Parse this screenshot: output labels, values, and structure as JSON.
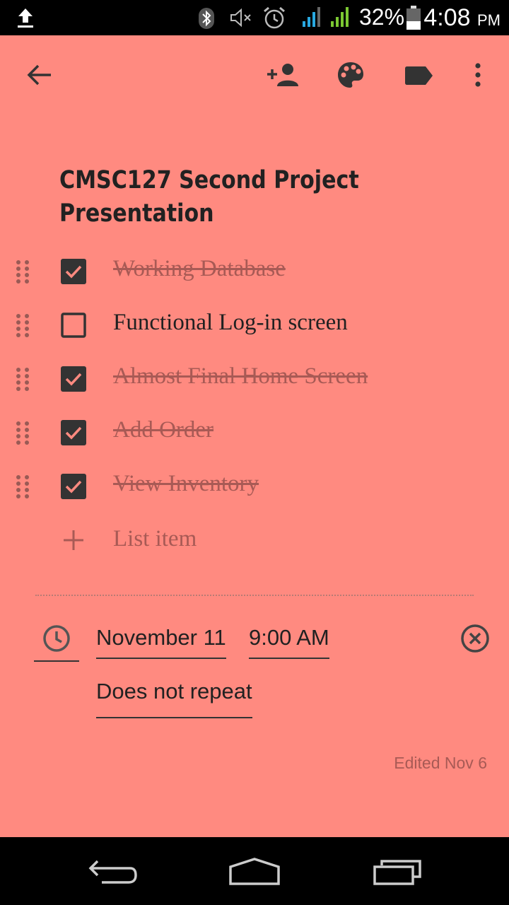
{
  "status_bar": {
    "battery_percent": "32%",
    "time": "4:08",
    "time_suffix": "PM"
  },
  "toolbar": {
    "icons": [
      "back-arrow-icon",
      "add-collaborator-icon",
      "palette-icon",
      "label-icon",
      "more-vert-icon"
    ]
  },
  "note": {
    "title_line1": "CMSC127 Second Project",
    "title_line2": "Presentation",
    "items": [
      {
        "label": "Working Database",
        "checked": true
      },
      {
        "label": "Functional Log-in screen",
        "checked": false
      },
      {
        "label": "Almost Final Home Screen",
        "checked": true
      },
      {
        "label": "Add Order",
        "checked": true
      },
      {
        "label": "View Inventory",
        "checked": true
      }
    ],
    "add_item_placeholder": "List item"
  },
  "reminder": {
    "date": "November 11",
    "time": "9:00 AM",
    "repeat": "Does not repeat"
  },
  "footer": {
    "edited": "Edited Nov 6"
  },
  "colors": {
    "note_background": "#ff8a80",
    "checked_text": "#a85a55",
    "text": "#212121"
  }
}
